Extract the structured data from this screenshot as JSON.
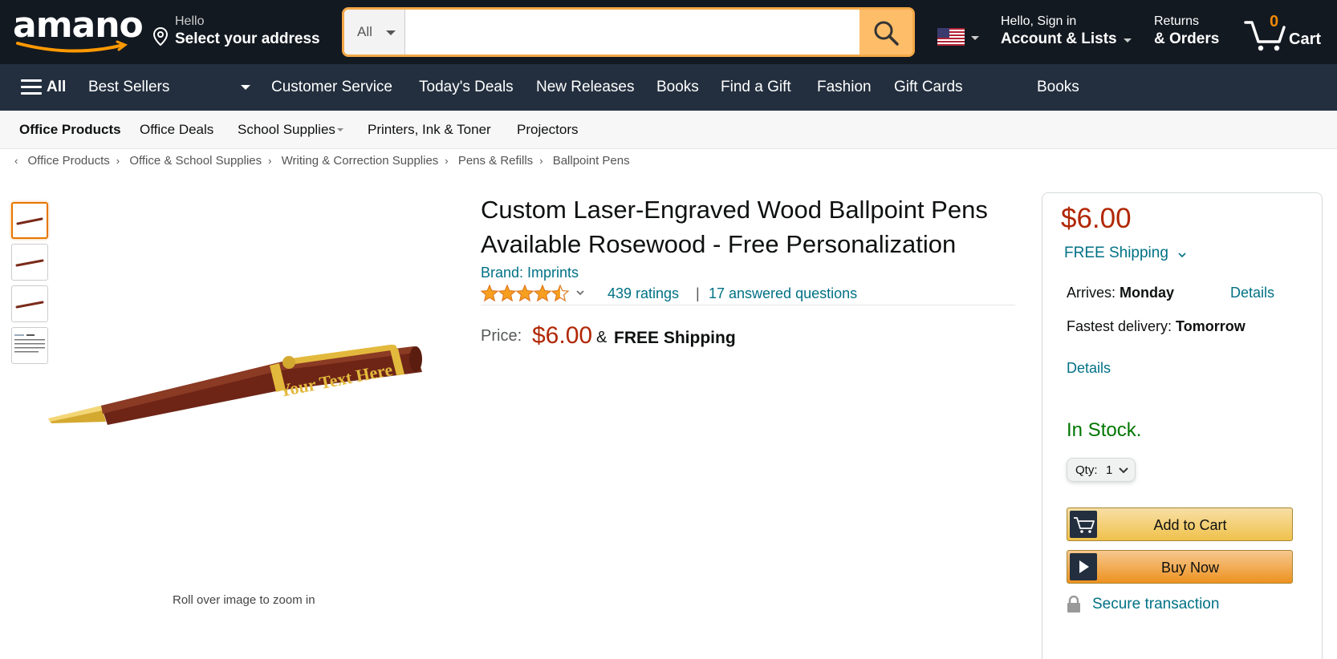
{
  "header": {
    "logo_text": "amano",
    "address_line1": "Hello",
    "address_line2": "Select your address",
    "search_category": "All",
    "search_value": "",
    "account_line1": "Hello, Sign in",
    "account_line2": "Account & Lists",
    "returns_line1": "Returns",
    "returns_line2": "& Orders",
    "cart_count": "0",
    "cart_label": "Cart"
  },
  "nav": {
    "all_label": "All",
    "items": [
      "Best Sellers",
      "Customer Service",
      "Today's Deals",
      "New Releases",
      "Books",
      "Find a Gift",
      "Fashion",
      "Gift Cards",
      "Books"
    ]
  },
  "subnav": {
    "items": [
      "Office Products",
      "Office Deals",
      "School Supplies",
      "Printers, Ink & Toner",
      "Projectors"
    ]
  },
  "breadcrumb": [
    "Office Products",
    "Office & School Supplies",
    "Writing & Correction Supplies",
    "Pens & Refills",
    "Ballpoint Pens"
  ],
  "gallery": {
    "engraving_text": "Your Text Here",
    "rollover_hint": "Roll over image to zoom in"
  },
  "product": {
    "title": "Custom Laser-Engraved Wood Ballpoint Pens Available Rosewood - Free Personalization",
    "brand": "Brand: Imprints",
    "rating": 4.5,
    "ratings_count": "439 ratings",
    "separator": "|",
    "answered_questions": "17 answered questions",
    "price_label": "Price:",
    "price": "$6.00",
    "amp": "&",
    "shipping": "FREE Shipping"
  },
  "buybox": {
    "price": "$6.00",
    "shipping": "FREE Shipping",
    "arrives_label": "Arrives: ",
    "arrives_day": "Monday",
    "details_link": "Details",
    "fastest_label": "Fastest delivery: ",
    "fastest_day": "Tomorrow",
    "details_link2": "Details",
    "stock": "In Stock.",
    "qty_label": "Qty:",
    "qty_value": "1",
    "add_to_cart": "Add to Cart",
    "buy_now": "Buy Now",
    "secure": "Secure transaction"
  },
  "colors": {
    "header_bg": "#131921",
    "nav_bg": "#232f3e",
    "search_button": "#febd69",
    "price": "#b12704",
    "link": "#007185",
    "in_stock": "#007600",
    "cart_count": "#f08804"
  }
}
